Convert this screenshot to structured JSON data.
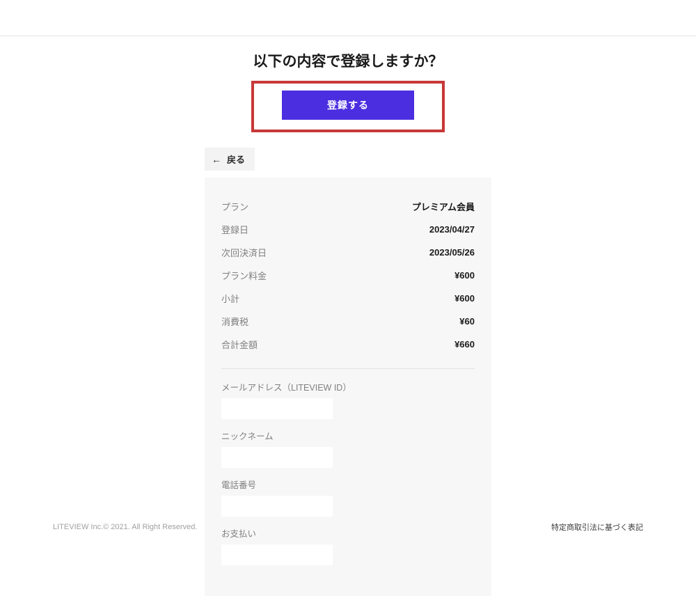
{
  "header": {
    "title": "以下の内容で登録しますか？",
    "register_button": "登録する"
  },
  "nav": {
    "back_label": "戻る"
  },
  "details": {
    "rows": [
      {
        "label": "プラン",
        "value": "プレミアム会員"
      },
      {
        "label": "登録日",
        "value": "2023/04/27"
      },
      {
        "label": "次回決済日",
        "value": "2023/05/26"
      },
      {
        "label": "プラン料金",
        "value": "¥600"
      },
      {
        "label": "小計",
        "value": "¥600"
      },
      {
        "label": "消費税",
        "value": "¥60"
      },
      {
        "label": "合計金額",
        "value": "¥660"
      }
    ]
  },
  "form": {
    "email_label": "メールアドレス（LITEVIEW ID）",
    "nickname_label": "ニックネーム",
    "phone_label": "電話番号",
    "payment_label": "お支払い"
  },
  "footer": {
    "copyright": "LITEVIEW Inc.© 2021. All Right Reserved.",
    "legal_link": "特定商取引法に基づく表記"
  }
}
